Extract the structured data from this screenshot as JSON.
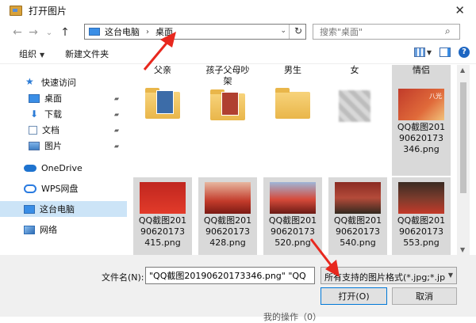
{
  "window": {
    "title": "打开图片",
    "close_glyph": "✕"
  },
  "nav": {
    "back": "←",
    "forward": "→",
    "recent": "⌄",
    "up": "↑",
    "breadcrumb": [
      "这台电脑",
      "桌面"
    ],
    "separator": "›",
    "dropdown": "⌄",
    "refresh": "↻",
    "search_placeholder": "搜索\"桌面\"",
    "search_icon": "⌕"
  },
  "toolbar": {
    "organize": "组织",
    "new_folder": "新建文件夹",
    "caret": "▼",
    "help": "?"
  },
  "sidebar": {
    "items": [
      {
        "label": "快速访问",
        "icon": "star-icon"
      },
      {
        "label": "桌面",
        "icon": "desktop-icon",
        "pinned": true
      },
      {
        "label": "下载",
        "icon": "download-icon",
        "pinned": true
      },
      {
        "label": "文档",
        "icon": "document-icon",
        "pinned": true
      },
      {
        "label": "图片",
        "icon": "picture-icon",
        "pinned": true
      },
      {
        "label": "OneDrive",
        "icon": "cloud-icon"
      },
      {
        "label": "WPS网盘",
        "icon": "cloud-drive-icon"
      },
      {
        "label": "这台电脑",
        "icon": "computer-icon",
        "selected": true
      },
      {
        "label": "网络",
        "icon": "network-icon"
      }
    ],
    "pin_glyph": "📌"
  },
  "files": {
    "row1": [
      {
        "label": "父亲",
        "kind": "folder"
      },
      {
        "label": "孩子父母吵架",
        "kind": "folder"
      },
      {
        "label": "男生",
        "kind": "folder"
      },
      {
        "label": "女",
        "kind": "blurred"
      },
      {
        "label": "情侣",
        "kind": "image",
        "caption": "QQ截图20190620173346.png",
        "selected": true
      }
    ],
    "row2": [
      {
        "caption": "QQ截图20190620173415.png"
      },
      {
        "caption": "QQ截图20190620173428.png"
      },
      {
        "caption": "QQ截图20190620173520.png"
      },
      {
        "caption": "QQ截图20190620173540.png"
      },
      {
        "caption": "QQ截图20190620173553.png"
      }
    ],
    "thumb_overlay_text": "八光"
  },
  "bottom": {
    "filename_label": "文件名(N):",
    "filename_value": "\"QQ截图20190620173346.png\" \"QQ",
    "filetype": "所有支持的图片格式(*.jpg;*.jp",
    "open_button": "打开(O)",
    "cancel_button": "取消",
    "background_text": "我的操作（0）"
  },
  "colors": {
    "arrow": "#e8281e",
    "selection": "#cce4f7",
    "accent": "#0078d7"
  }
}
